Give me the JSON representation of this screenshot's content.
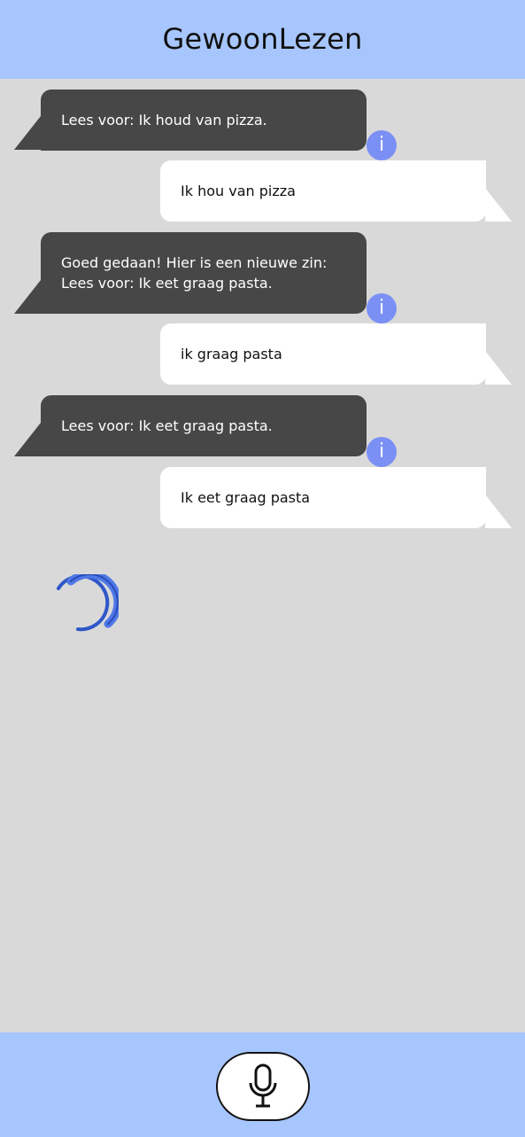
{
  "app": {
    "title": "GewoonLezen"
  },
  "messages": [
    {
      "sender": "bot",
      "text": "Lees voor: Ik houd van pizza.",
      "info_icon": "i"
    },
    {
      "sender": "user",
      "text": "Ik hou van pizza"
    },
    {
      "sender": "bot",
      "text": "Goed gedaan! Hier is een nieuwe zin: Lees voor: Ik eet graag pasta.",
      "info_icon": "i"
    },
    {
      "sender": "user",
      "text": "ik graag pasta"
    },
    {
      "sender": "bot",
      "text": "Lees voor: Ik eet graag pasta.",
      "info_icon": "i"
    },
    {
      "sender": "user",
      "text": "Ik eet graag pasta"
    }
  ],
  "status": {
    "loading": true
  },
  "footer": {
    "mic_icon": "microphone-icon"
  },
  "colors": {
    "header": "#a8c6fe",
    "background": "#d9d9d9",
    "bot_bubble": "#474747",
    "user_bubble": "#ffffff",
    "info": "#7b90f5",
    "spinner": "#3a5fd0"
  }
}
